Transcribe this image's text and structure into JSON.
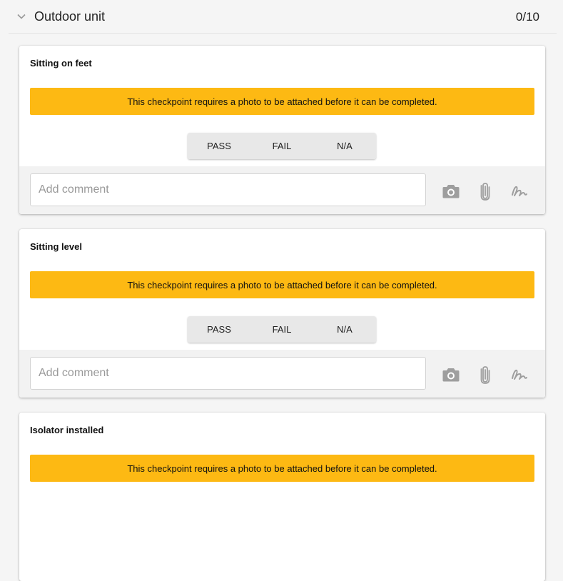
{
  "section": {
    "title": "Outdoor unit",
    "count": "0/10"
  },
  "warning_text": "This checkpoint requires a photo to be attached before it can be completed.",
  "buttons": {
    "pass": "PASS",
    "fail": "FAIL",
    "na": "N/A"
  },
  "comment_placeholder": "Add comment",
  "checkpoints": [
    {
      "title": "Sitting on feet"
    },
    {
      "title": "Sitting level"
    },
    {
      "title": "Isolator installed"
    }
  ],
  "colors": {
    "warning": "#fdb913",
    "icon": "#9e9e9e"
  },
  "icons": [
    "chevron-down-icon",
    "camera-icon",
    "paperclip-icon",
    "signature-icon"
  ]
}
